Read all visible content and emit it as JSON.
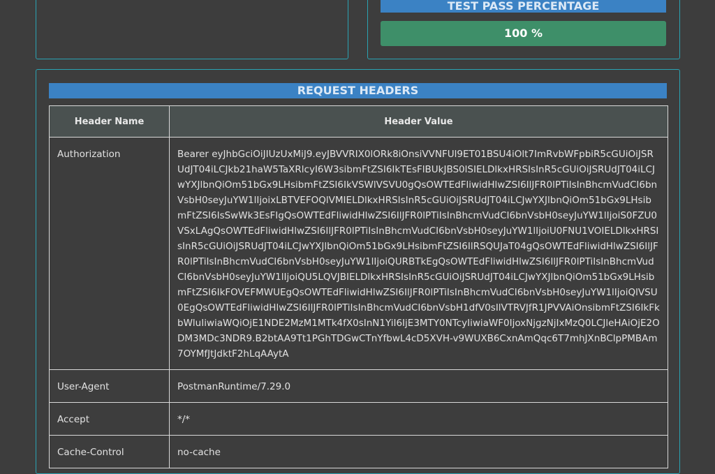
{
  "summary": {
    "pass_header": "TEST PASS PERCENTAGE",
    "pass_value": "100 %",
    "pass_color": "#3e8f69",
    "header_color": "#3b82c4"
  },
  "request_headers": {
    "title": "REQUEST HEADERS",
    "columns": [
      "Header Name",
      "Header Value"
    ],
    "rows": [
      {
        "name": "Authorization",
        "value": "Bearer eyJhbGciOiJIUzUxMiJ9.eyJBVVRIX0lORk8iOnsiVVNFUl9ET01BSU4iOlt7ImRvbWFpbiR5cGUiOiJSRUdJT04iLCJkb21haW5TaXRlcyI6W3sibmFtZSI6IkTEsFlBUkJBS0lSIELDlkxHRSIsInR5cGUiOiJSRUdJT04iLCJwYXJlbnQiOm51bGx9LHsibmFtZSI6IkVSWlVSVU0gQsOWTEdFliwidHlwZSI6IlJFR0lPTiIsInBhcmVudCI6bnVsbH0seyJuYW1lIjoixLBTVEFOQlVMIELDlkxHRSIsInR5cGUiOiJSRUdJT04iLCJwYXJlbnQiOm51bGx9LHsibmFtZSI6IsSwWk3EsFIgQsOWTEdFliwidHlwZSI6IlJFR0lPTiIsInBhcmVudCI6bnVsbH0seyJuYW1lIjoiS0FZU0VSxLAgQsOWTEdFliwidHlwZSI6IlJFR0lPTiIsInBhcmVudCI6bnVsbH0seyJuYW1lIjoiU0FNU1VOIELDlkxHRSIsInR5cGUiOiJSRUdJT04iLCJwYXJlbnQiOm51bGx9LHsibmFtZSI6IlRSQUJaT04gQsOWTEdFliwidHlwZSI6IlJFR0lPTiIsInBhcmVudCI6bnVsbH0seyJuYW1lIjoiQURBTkEgQsOWTEdFliwidHlwZSI6IlJFR0lPTiIsInBhcmVudCI6bnVsbH0seyJuYW1lIjoiQU5LQVJBIELDlkxHRSIsInR5cGUiOiJSRUdJT04iLCJwYXJlbnQiOm51bGx9LHsibmFtZSI6IkFOVEFMWUEgQsOWTEdFliwidHlwZSI6IlJFR0lPTiIsInBhcmVudCI6bnVsbH0seyJuYW1lIjoiQlVSU0EgQsOWTEdFliwidHlwZSI6IlJFR0lPTiIsInBhcmVudCI6bnVsbH1dfV0sIlVTRVJfR1JPVVAiOnsibmFtZSI6IkFkbWluIiwiaWQiOjE1NDE2MzM1MTk4fX0sInN1YiI6IjE3MTY0NTcyIiwiaWF0IjoxNjgzNjIxMzQ0LCJleHAiOjE2ODM3MDc3NDR9.B2btAA9Tt1PGhTDGwCTnYfbwL4cD5XVH-v9WUXB6CxnAmQqc6T7mhJXnBClpPMBAm7OYMfJtJdktF2hLqAAytA"
      },
      {
        "name": "User-Agent",
        "value": "PostmanRuntime/7.29.0"
      },
      {
        "name": "Accept",
        "value": "*/*"
      },
      {
        "name": "Cache-Control",
        "value": "no-cache"
      }
    ]
  }
}
